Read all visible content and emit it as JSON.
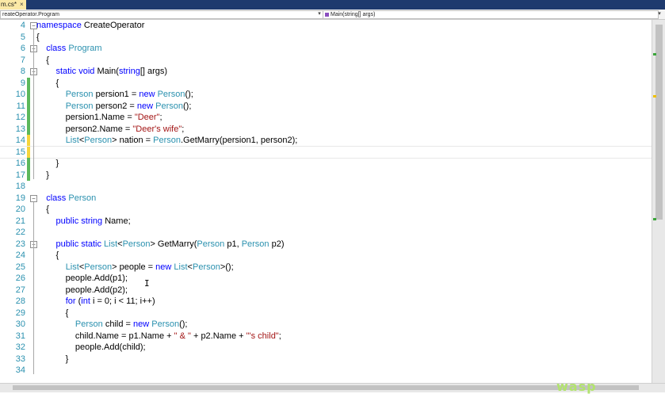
{
  "tab": {
    "filename": "m.cs*",
    "close": "×"
  },
  "nav": {
    "type_dropdown": "reateOperator.Program",
    "member_dropdown": "Main(string[] args)",
    "dropdown_glyph": "▾"
  },
  "code": {
    "lines": [
      {
        "n": "4",
        "t": [
          [
            "kw",
            "namespace"
          ],
          [
            "pl",
            " CreateOperator"
          ]
        ]
      },
      {
        "n": "5",
        "t": [
          [
            "pl",
            "{"
          ]
        ]
      },
      {
        "n": "6",
        "t": [
          [
            "pl",
            "    "
          ],
          [
            "kw",
            "class"
          ],
          [
            "pl",
            " "
          ],
          [
            "ty",
            "Program"
          ]
        ]
      },
      {
        "n": "7",
        "t": [
          [
            "pl",
            "    {"
          ]
        ]
      },
      {
        "n": "8",
        "t": [
          [
            "pl",
            "        "
          ],
          [
            "kw",
            "static"
          ],
          [
            "pl",
            " "
          ],
          [
            "kw",
            "void"
          ],
          [
            "pl",
            " Main("
          ],
          [
            "kw",
            "string"
          ],
          [
            "pl",
            "[] args)"
          ]
        ]
      },
      {
        "n": "9",
        "t": [
          [
            "pl",
            "        {"
          ]
        ]
      },
      {
        "n": "10",
        "t": [
          [
            "pl",
            "            "
          ],
          [
            "ty",
            "Person"
          ],
          [
            "pl",
            " persion1 = "
          ],
          [
            "kw",
            "new"
          ],
          [
            "pl",
            " "
          ],
          [
            "ty",
            "Person"
          ],
          [
            "pl",
            "();"
          ]
        ]
      },
      {
        "n": "11",
        "t": [
          [
            "pl",
            "            "
          ],
          [
            "ty",
            "Person"
          ],
          [
            "pl",
            " person2 = "
          ],
          [
            "kw",
            "new"
          ],
          [
            "pl",
            " "
          ],
          [
            "ty",
            "Person"
          ],
          [
            "pl",
            "();"
          ]
        ]
      },
      {
        "n": "12",
        "t": [
          [
            "pl",
            "            persion1.Name = "
          ],
          [
            "st",
            "\"Deer\""
          ],
          [
            "pl",
            ";"
          ]
        ]
      },
      {
        "n": "13",
        "t": [
          [
            "pl",
            "            person2.Name = "
          ],
          [
            "st",
            "\"Deer's wife\""
          ],
          [
            "pl",
            ";"
          ]
        ]
      },
      {
        "n": "14",
        "t": [
          [
            "pl",
            "            "
          ],
          [
            "ty",
            "List"
          ],
          [
            "pl",
            "<"
          ],
          [
            "ty",
            "Person"
          ],
          [
            "pl",
            "> nation = "
          ],
          [
            "ty",
            "Person"
          ],
          [
            "pl",
            ".GetMarry(persion1, person2);"
          ]
        ]
      },
      {
        "n": "15",
        "t": [
          [
            "pl",
            ""
          ]
        ]
      },
      {
        "n": "16",
        "t": [
          [
            "pl",
            "        }"
          ]
        ]
      },
      {
        "n": "17",
        "t": [
          [
            "pl",
            "    }"
          ]
        ]
      },
      {
        "n": "18",
        "t": [
          [
            "pl",
            ""
          ]
        ]
      },
      {
        "n": "19",
        "t": [
          [
            "pl",
            "    "
          ],
          [
            "kw",
            "class"
          ],
          [
            "pl",
            " "
          ],
          [
            "ty",
            "Person"
          ]
        ]
      },
      {
        "n": "20",
        "t": [
          [
            "pl",
            "    {"
          ]
        ]
      },
      {
        "n": "21",
        "t": [
          [
            "pl",
            "        "
          ],
          [
            "kw",
            "public"
          ],
          [
            "pl",
            " "
          ],
          [
            "kw",
            "string"
          ],
          [
            "pl",
            " Name;"
          ]
        ]
      },
      {
        "n": "22",
        "t": [
          [
            "pl",
            ""
          ]
        ]
      },
      {
        "n": "23",
        "t": [
          [
            "pl",
            "        "
          ],
          [
            "kw",
            "public"
          ],
          [
            "pl",
            " "
          ],
          [
            "kw",
            "static"
          ],
          [
            "pl",
            " "
          ],
          [
            "ty",
            "List"
          ],
          [
            "pl",
            "<"
          ],
          [
            "ty",
            "Person"
          ],
          [
            "pl",
            "> GetMarry("
          ],
          [
            "ty",
            "Person"
          ],
          [
            "pl",
            " p1, "
          ],
          [
            "ty",
            "Person"
          ],
          [
            "pl",
            " p2)"
          ]
        ]
      },
      {
        "n": "24",
        "t": [
          [
            "pl",
            "        {"
          ]
        ]
      },
      {
        "n": "25",
        "t": [
          [
            "pl",
            "            "
          ],
          [
            "ty",
            "List"
          ],
          [
            "pl",
            "<"
          ],
          [
            "ty",
            "Person"
          ],
          [
            "pl",
            "> people = "
          ],
          [
            "kw",
            "new"
          ],
          [
            "pl",
            " "
          ],
          [
            "ty",
            "List"
          ],
          [
            "pl",
            "<"
          ],
          [
            "ty",
            "Person"
          ],
          [
            "pl",
            ">();"
          ]
        ]
      },
      {
        "n": "26",
        "t": [
          [
            "pl",
            "            people.Add(p1);"
          ]
        ]
      },
      {
        "n": "27",
        "t": [
          [
            "pl",
            "            people.Add(p2);"
          ]
        ]
      },
      {
        "n": "28",
        "t": [
          [
            "pl",
            "            "
          ],
          [
            "kw",
            "for"
          ],
          [
            "pl",
            " ("
          ],
          [
            "kw",
            "int"
          ],
          [
            "pl",
            " i = 0; i < 11; i++)"
          ]
        ]
      },
      {
        "n": "29",
        "t": [
          [
            "pl",
            "            {"
          ]
        ]
      },
      {
        "n": "30",
        "t": [
          [
            "pl",
            "                "
          ],
          [
            "ty",
            "Person"
          ],
          [
            "pl",
            " child = "
          ],
          [
            "kw",
            "new"
          ],
          [
            "pl",
            " "
          ],
          [
            "ty",
            "Person"
          ],
          [
            "pl",
            "();"
          ]
        ]
      },
      {
        "n": "31",
        "t": [
          [
            "pl",
            "                child.Name = p1.Name + "
          ],
          [
            "st",
            "\" & \""
          ],
          [
            "pl",
            " + p2.Name + "
          ],
          [
            "st",
            "\"'s child\""
          ],
          [
            "pl",
            ";"
          ]
        ]
      },
      {
        "n": "32",
        "t": [
          [
            "pl",
            "                people.Add(child);"
          ]
        ]
      },
      {
        "n": "33",
        "t": [
          [
            "pl",
            "            }"
          ]
        ]
      },
      {
        "n": "34",
        "t": [
          [
            "pl",
            ""
          ]
        ]
      }
    ]
  },
  "status": {
    "zoom": ""
  },
  "watermark": "wasp"
}
